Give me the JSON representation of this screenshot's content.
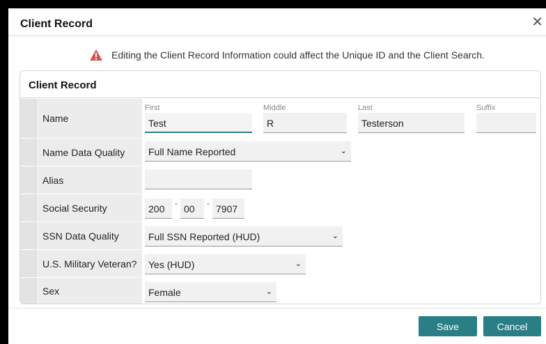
{
  "dialog": {
    "title": "Client Record",
    "close": "✕"
  },
  "warning": {
    "text": "Editing the Client Record Information could affect the Unique ID and the Client Search."
  },
  "panel": {
    "title": "Client Record"
  },
  "name": {
    "label": "Name",
    "first_label": "First",
    "first_value": "Test",
    "middle_label": "Middle",
    "middle_value": "R",
    "last_label": "Last",
    "last_value": "Testerson",
    "suffix_label": "Suffix",
    "suffix_value": ""
  },
  "name_quality": {
    "label": "Name Data Quality",
    "value": "Full Name Reported"
  },
  "alias": {
    "label": "Alias",
    "value": ""
  },
  "ssn": {
    "label": "Social Security",
    "part1": "200",
    "part2": "00",
    "part3": "7907",
    "sep": "-"
  },
  "ssn_quality": {
    "label": "SSN Data Quality",
    "value": "Full SSN Reported (HUD)"
  },
  "veteran": {
    "label": "U.S. Military Veteran?",
    "value": "Yes (HUD)"
  },
  "sex": {
    "label": "Sex",
    "value": "Female"
  },
  "buttons": {
    "save": "Save",
    "cancel": "Cancel"
  },
  "colors": {
    "accent": "#2a7f86",
    "warning": "#d9534f"
  }
}
